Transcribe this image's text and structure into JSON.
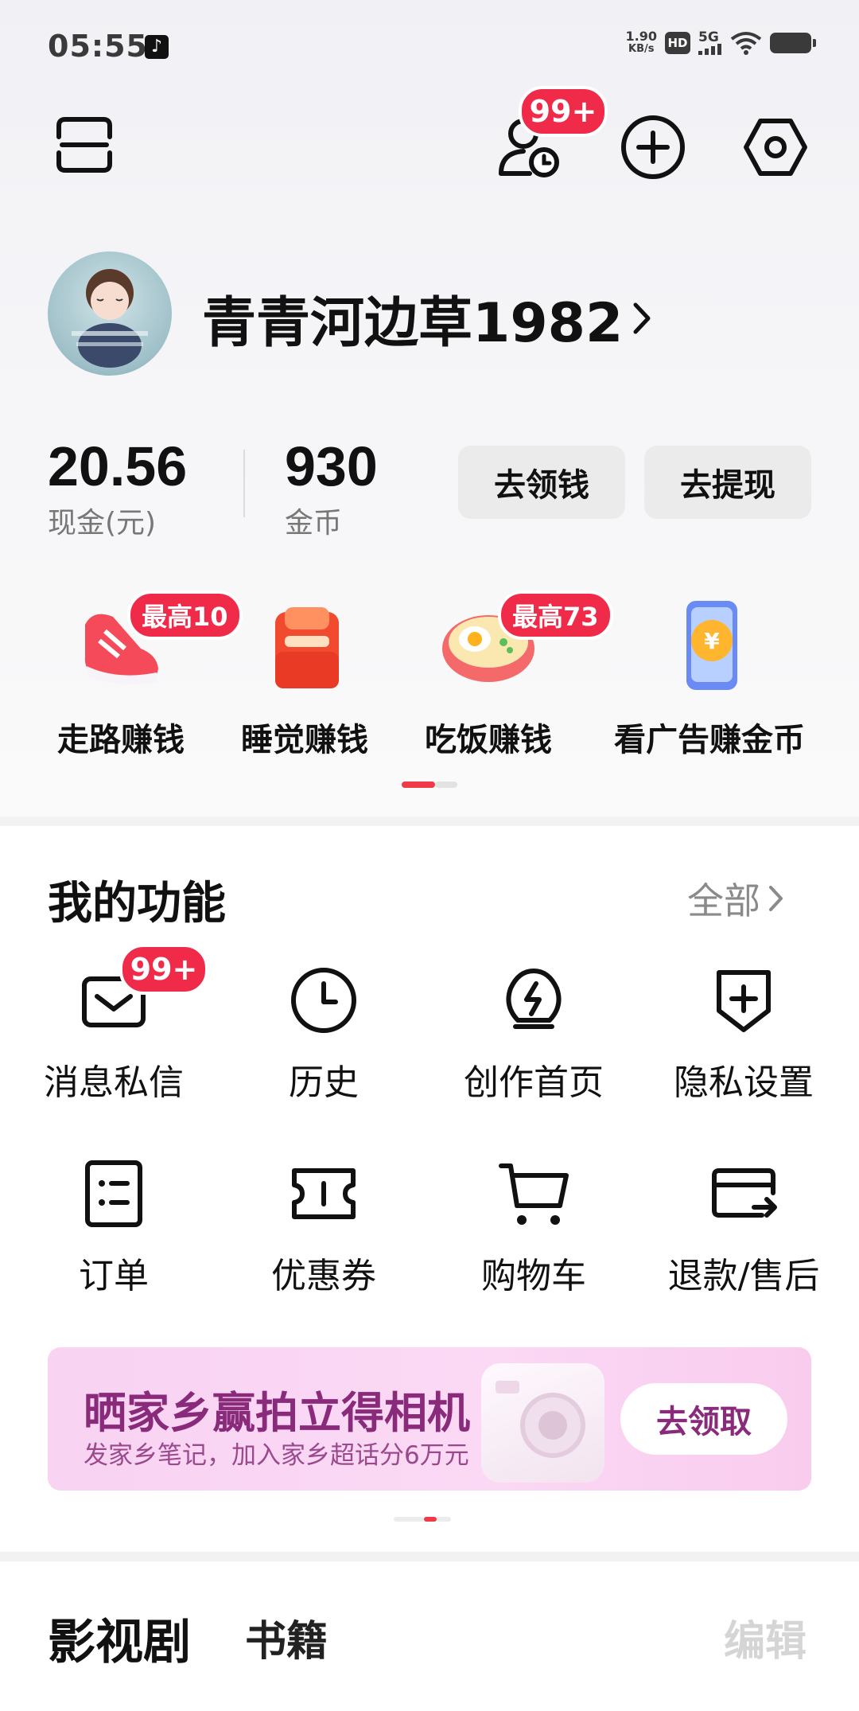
{
  "status_bar": {
    "time": "05:55",
    "net_speed_value": "1.90",
    "net_speed_unit": "KB/s",
    "hd": "HD",
    "network": "5G",
    "icons": [
      "tiktok-icon",
      "signal-icon",
      "wifi-icon",
      "battery-icon"
    ]
  },
  "header": {
    "scan_icon": "scan-icon",
    "visitors_badge": "99+",
    "add_icon": "add-icon",
    "settings_icon": "settings-icon"
  },
  "profile": {
    "username": "青青河边草1982",
    "chevron": "›"
  },
  "wallet": {
    "cash_value": "20.56",
    "cash_label": "现金(元)",
    "coins_value": "930",
    "coins_label": "金币",
    "earn_button": "去领钱",
    "withdraw_button": "去提现"
  },
  "earn_items": [
    {
      "label": "走路赚钱",
      "badge": "最高10",
      "icon": "sneaker-icon"
    },
    {
      "label": "睡觉赚钱",
      "badge": "",
      "icon": "bed-icon"
    },
    {
      "label": "吃饭赚钱",
      "badge": "最高73",
      "icon": "noodle-bowl-icon"
    },
    {
      "label": "看广告赚金币",
      "badge": "",
      "icon": "phone-coin-icon"
    }
  ],
  "functions": {
    "title": "我的功能",
    "all_link": "全部",
    "items": [
      {
        "label": "消息私信",
        "icon": "message-icon",
        "badge": "99+"
      },
      {
        "label": "历史",
        "icon": "clock-icon"
      },
      {
        "label": "创作首页",
        "icon": "lightbulb-icon"
      },
      {
        "label": "隐私设置",
        "icon": "shield-icon"
      },
      {
        "label": "订单",
        "icon": "order-icon"
      },
      {
        "label": "优惠券",
        "icon": "ticket-icon"
      },
      {
        "label": "购物车",
        "icon": "cart-icon"
      },
      {
        "label": "退款/售后",
        "icon": "refund-card-icon"
      }
    ]
  },
  "banner": {
    "title": "晒家乡赢拍立得相机",
    "subtitle": "发家乡笔记，加入家乡超话分6万元",
    "button": "去领取"
  },
  "bottom_tabs": {
    "main": "影视剧",
    "second": "书籍",
    "edit": "编辑"
  },
  "colors": {
    "accent_red": "#f02b4a",
    "banner_pink": "#f8d3f2",
    "banner_text": "#8a2a7a"
  }
}
